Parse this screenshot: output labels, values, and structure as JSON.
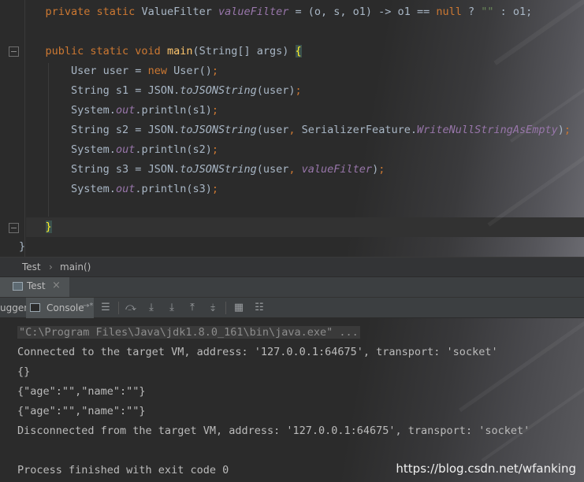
{
  "editor": {
    "lines": [
      {
        "indent": "    ",
        "tokens": [
          [
            "kw",
            "private static "
          ],
          [
            "plain",
            "ValueFilter "
          ],
          [
            "field",
            "valueFilter"
          ],
          [
            "plain",
            " = (o, s, o1) -> o1 == "
          ],
          [
            "kw",
            "null"
          ],
          [
            "plain",
            " ? "
          ],
          [
            "str",
            "\"\""
          ],
          [
            "plain",
            " : o1;"
          ]
        ]
      },
      {
        "indent": "",
        "tokens": []
      },
      {
        "indent": "    ",
        "tokens": [
          [
            "kw",
            "public static void "
          ],
          [
            "fn",
            "main"
          ],
          [
            "plain",
            "(String[] args) "
          ],
          [
            "paren",
            "{"
          ]
        ]
      },
      {
        "indent": "        ",
        "tokens": [
          [
            "plain",
            "User user = "
          ],
          [
            "kw",
            "new "
          ],
          [
            "plain",
            "User()"
          ],
          [
            "kw",
            ";"
          ]
        ]
      },
      {
        "indent": "        ",
        "tokens": [
          [
            "plain",
            "String s1 = JSON."
          ],
          [
            "static",
            "toJSONString"
          ],
          [
            "plain",
            "(user)"
          ],
          [
            "kw",
            ";"
          ]
        ]
      },
      {
        "indent": "        ",
        "tokens": [
          [
            "plain",
            "System."
          ],
          [
            "field",
            "out"
          ],
          [
            "plain",
            ".println(s1)"
          ],
          [
            "kw",
            ";"
          ]
        ]
      },
      {
        "indent": "        ",
        "tokens": [
          [
            "plain",
            "String s2 = JSON."
          ],
          [
            "static",
            "toJSONString"
          ],
          [
            "plain",
            "(user"
          ],
          [
            "kw",
            ", "
          ],
          [
            "plain",
            "SerializerFeature."
          ],
          [
            "field",
            "WriteNullStringAsEmpty"
          ],
          [
            "plain",
            ")"
          ],
          [
            "kw",
            ";"
          ]
        ]
      },
      {
        "indent": "        ",
        "tokens": [
          [
            "plain",
            "System."
          ],
          [
            "field",
            "out"
          ],
          [
            "plain",
            ".println(s2)"
          ],
          [
            "kw",
            ";"
          ]
        ]
      },
      {
        "indent": "        ",
        "tokens": [
          [
            "plain",
            "String s3 = JSON."
          ],
          [
            "static",
            "toJSONString"
          ],
          [
            "plain",
            "(user"
          ],
          [
            "kw",
            ", "
          ],
          [
            "field",
            "valueFilter"
          ],
          [
            "plain",
            ")"
          ],
          [
            "kw",
            ";"
          ]
        ]
      },
      {
        "indent": "        ",
        "tokens": [
          [
            "plain",
            "System."
          ],
          [
            "field",
            "out"
          ],
          [
            "plain",
            ".println(s3)"
          ],
          [
            "kw",
            ";"
          ]
        ]
      },
      {
        "indent": "",
        "tokens": []
      },
      {
        "indent": "    ",
        "tokens": [
          [
            "paren",
            "}"
          ]
        ]
      },
      {
        "indent": "",
        "tokens": [
          [
            "plain",
            "}"
          ]
        ]
      }
    ]
  },
  "breadcrumb": {
    "class_name": "Test",
    "separator": "›",
    "method": "main()"
  },
  "run_panel": {
    "tab_label": "Test",
    "close": "×"
  },
  "toolbar": {
    "debugger_tab": "ugger",
    "console_tab": "Console",
    "console_arrow": "→*"
  },
  "console": {
    "lines": [
      "\"C:\\Program Files\\Java\\jdk1.8.0_161\\bin\\java.exe\" ...",
      "Connected to the target VM, address: '127.0.0.1:64675', transport: 'socket'",
      "{}",
      "{\"age\":\"\",\"name\":\"\"}",
      "{\"age\":\"\",\"name\":\"\"}",
      "Disconnected from the target VM, address: '127.0.0.1:64675', transport: 'socket'",
      "",
      "Process finished with exit code 0"
    ]
  },
  "watermark": "https://blog.csdn.net/wfanking",
  "colors": {
    "keyword": "#cc7832",
    "method": "#ffc66d",
    "field": "#9876aa",
    "string": "#6a8759",
    "text": "#a9b7c6"
  }
}
